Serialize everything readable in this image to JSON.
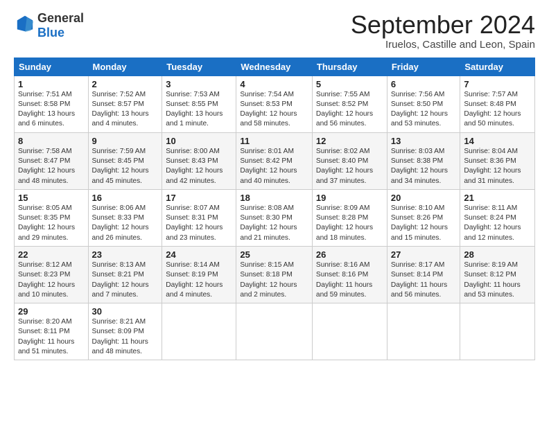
{
  "logo": {
    "general": "General",
    "blue": "Blue"
  },
  "header": {
    "month": "September 2024",
    "location": "Iruelos, Castille and Leon, Spain"
  },
  "weekdays": [
    "Sunday",
    "Monday",
    "Tuesday",
    "Wednesday",
    "Thursday",
    "Friday",
    "Saturday"
  ],
  "weeks": [
    [
      {
        "day": "1",
        "info": "Sunrise: 7:51 AM\nSunset: 8:58 PM\nDaylight: 13 hours\nand 6 minutes."
      },
      {
        "day": "2",
        "info": "Sunrise: 7:52 AM\nSunset: 8:57 PM\nDaylight: 13 hours\nand 4 minutes."
      },
      {
        "day": "3",
        "info": "Sunrise: 7:53 AM\nSunset: 8:55 PM\nDaylight: 13 hours\nand 1 minute."
      },
      {
        "day": "4",
        "info": "Sunrise: 7:54 AM\nSunset: 8:53 PM\nDaylight: 12 hours\nand 58 minutes."
      },
      {
        "day": "5",
        "info": "Sunrise: 7:55 AM\nSunset: 8:52 PM\nDaylight: 12 hours\nand 56 minutes."
      },
      {
        "day": "6",
        "info": "Sunrise: 7:56 AM\nSunset: 8:50 PM\nDaylight: 12 hours\nand 53 minutes."
      },
      {
        "day": "7",
        "info": "Sunrise: 7:57 AM\nSunset: 8:48 PM\nDaylight: 12 hours\nand 50 minutes."
      }
    ],
    [
      {
        "day": "8",
        "info": "Sunrise: 7:58 AM\nSunset: 8:47 PM\nDaylight: 12 hours\nand 48 minutes."
      },
      {
        "day": "9",
        "info": "Sunrise: 7:59 AM\nSunset: 8:45 PM\nDaylight: 12 hours\nand 45 minutes."
      },
      {
        "day": "10",
        "info": "Sunrise: 8:00 AM\nSunset: 8:43 PM\nDaylight: 12 hours\nand 42 minutes."
      },
      {
        "day": "11",
        "info": "Sunrise: 8:01 AM\nSunset: 8:42 PM\nDaylight: 12 hours\nand 40 minutes."
      },
      {
        "day": "12",
        "info": "Sunrise: 8:02 AM\nSunset: 8:40 PM\nDaylight: 12 hours\nand 37 minutes."
      },
      {
        "day": "13",
        "info": "Sunrise: 8:03 AM\nSunset: 8:38 PM\nDaylight: 12 hours\nand 34 minutes."
      },
      {
        "day": "14",
        "info": "Sunrise: 8:04 AM\nSunset: 8:36 PM\nDaylight: 12 hours\nand 31 minutes."
      }
    ],
    [
      {
        "day": "15",
        "info": "Sunrise: 8:05 AM\nSunset: 8:35 PM\nDaylight: 12 hours\nand 29 minutes."
      },
      {
        "day": "16",
        "info": "Sunrise: 8:06 AM\nSunset: 8:33 PM\nDaylight: 12 hours\nand 26 minutes."
      },
      {
        "day": "17",
        "info": "Sunrise: 8:07 AM\nSunset: 8:31 PM\nDaylight: 12 hours\nand 23 minutes."
      },
      {
        "day": "18",
        "info": "Sunrise: 8:08 AM\nSunset: 8:30 PM\nDaylight: 12 hours\nand 21 minutes."
      },
      {
        "day": "19",
        "info": "Sunrise: 8:09 AM\nSunset: 8:28 PM\nDaylight: 12 hours\nand 18 minutes."
      },
      {
        "day": "20",
        "info": "Sunrise: 8:10 AM\nSunset: 8:26 PM\nDaylight: 12 hours\nand 15 minutes."
      },
      {
        "day": "21",
        "info": "Sunrise: 8:11 AM\nSunset: 8:24 PM\nDaylight: 12 hours\nand 12 minutes."
      }
    ],
    [
      {
        "day": "22",
        "info": "Sunrise: 8:12 AM\nSunset: 8:23 PM\nDaylight: 12 hours\nand 10 minutes."
      },
      {
        "day": "23",
        "info": "Sunrise: 8:13 AM\nSunset: 8:21 PM\nDaylight: 12 hours\nand 7 minutes."
      },
      {
        "day": "24",
        "info": "Sunrise: 8:14 AM\nSunset: 8:19 PM\nDaylight: 12 hours\nand 4 minutes."
      },
      {
        "day": "25",
        "info": "Sunrise: 8:15 AM\nSunset: 8:18 PM\nDaylight: 12 hours\nand 2 minutes."
      },
      {
        "day": "26",
        "info": "Sunrise: 8:16 AM\nSunset: 8:16 PM\nDaylight: 11 hours\nand 59 minutes."
      },
      {
        "day": "27",
        "info": "Sunrise: 8:17 AM\nSunset: 8:14 PM\nDaylight: 11 hours\nand 56 minutes."
      },
      {
        "day": "28",
        "info": "Sunrise: 8:19 AM\nSunset: 8:12 PM\nDaylight: 11 hours\nand 53 minutes."
      }
    ],
    [
      {
        "day": "29",
        "info": "Sunrise: 8:20 AM\nSunset: 8:11 PM\nDaylight: 11 hours\nand 51 minutes."
      },
      {
        "day": "30",
        "info": "Sunrise: 8:21 AM\nSunset: 8:09 PM\nDaylight: 11 hours\nand 48 minutes."
      },
      null,
      null,
      null,
      null,
      null
    ]
  ]
}
